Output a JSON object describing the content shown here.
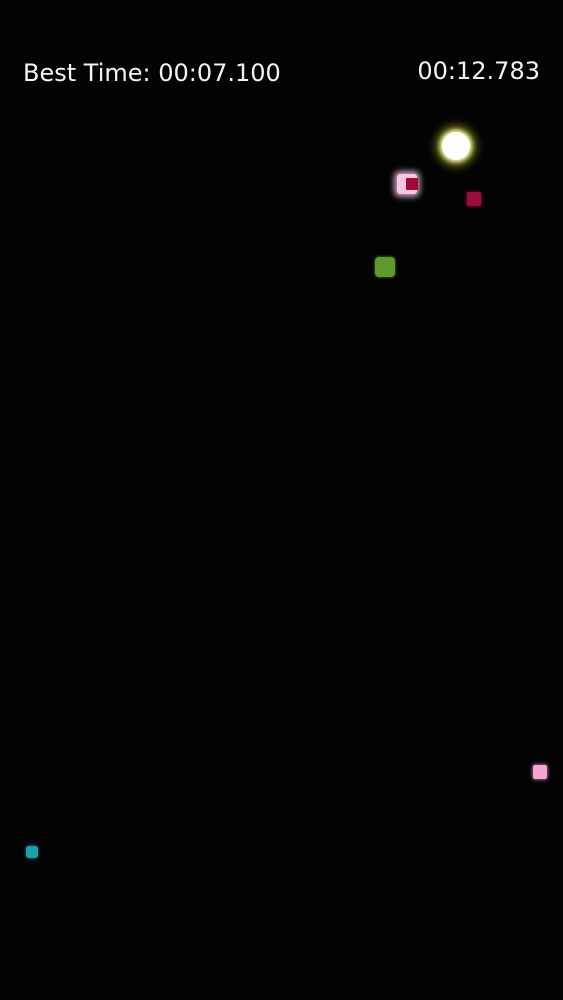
{
  "hud": {
    "best_time_label": "Best Time: 00:07.100",
    "current_time": "00:12.783"
  },
  "entities": {
    "player": {
      "shape": "circle",
      "color": "#ffffff",
      "glow": "#f0f028"
    },
    "obstacles": [
      {
        "name": "pink-glow-block",
        "color": "#f6c8e2",
        "core_color": "#a3083c"
      },
      {
        "name": "crimson-square",
        "color": "#9e0c3e"
      },
      {
        "name": "green-square",
        "color": "#5e9a2e"
      },
      {
        "name": "light-pink-square",
        "color": "#f3a6d0"
      },
      {
        "name": "teal-square",
        "color": "#18a2a4"
      }
    ]
  },
  "theme": {
    "background": "#030304",
    "text": "#f4f4f4"
  }
}
